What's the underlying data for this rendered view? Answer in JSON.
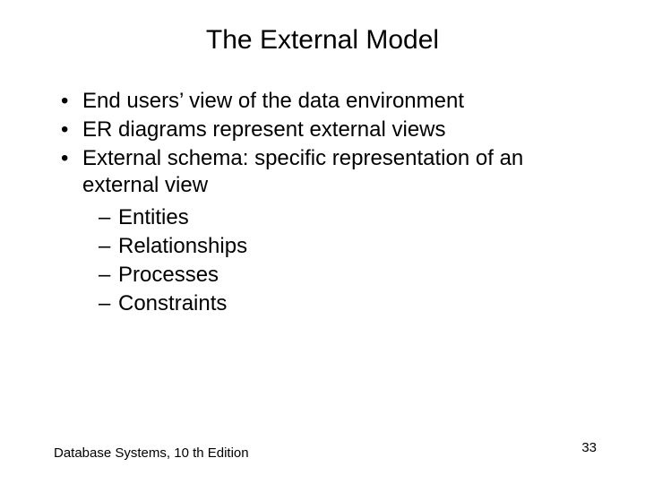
{
  "title": "The External Model",
  "bullets": [
    "End users’ view of the data environment",
    "ER diagrams represent external views",
    "External schema: specific representation of an external view"
  ],
  "sub_bullets": [
    "Entities",
    "Relationships",
    "Processes",
    "Constraints"
  ],
  "footer": {
    "source": "Database Systems, 10 th Edition",
    "page": "33"
  }
}
